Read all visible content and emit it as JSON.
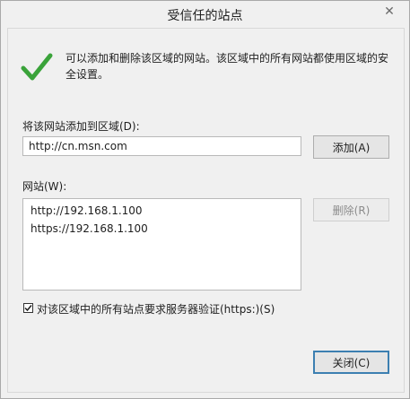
{
  "dialog": {
    "title": "受信任的站点",
    "close_glyph": "✕"
  },
  "info": {
    "icon": "checkmark-icon",
    "text": "可以添加和删除该区域的网站。该区域中的所有网站都使用区域的安全设置。"
  },
  "add_section": {
    "label": "将该网站添加到区域(D):",
    "input_value": "http://cn.msn.com",
    "add_button": "添加(A)"
  },
  "sites_section": {
    "label": "网站(W):",
    "sites": [
      "http://192.168.1.100",
      "https://192.168.1.100"
    ],
    "remove_button": "删除(R)"
  },
  "require_https": {
    "checked": true,
    "label": "对该区域中的所有站点要求服务器验证(https:)(S)"
  },
  "footer": {
    "close_button": "关闭(C)"
  },
  "colors": {
    "check_green": "#3aa33a",
    "window_bg": "#f0f0f0"
  }
}
